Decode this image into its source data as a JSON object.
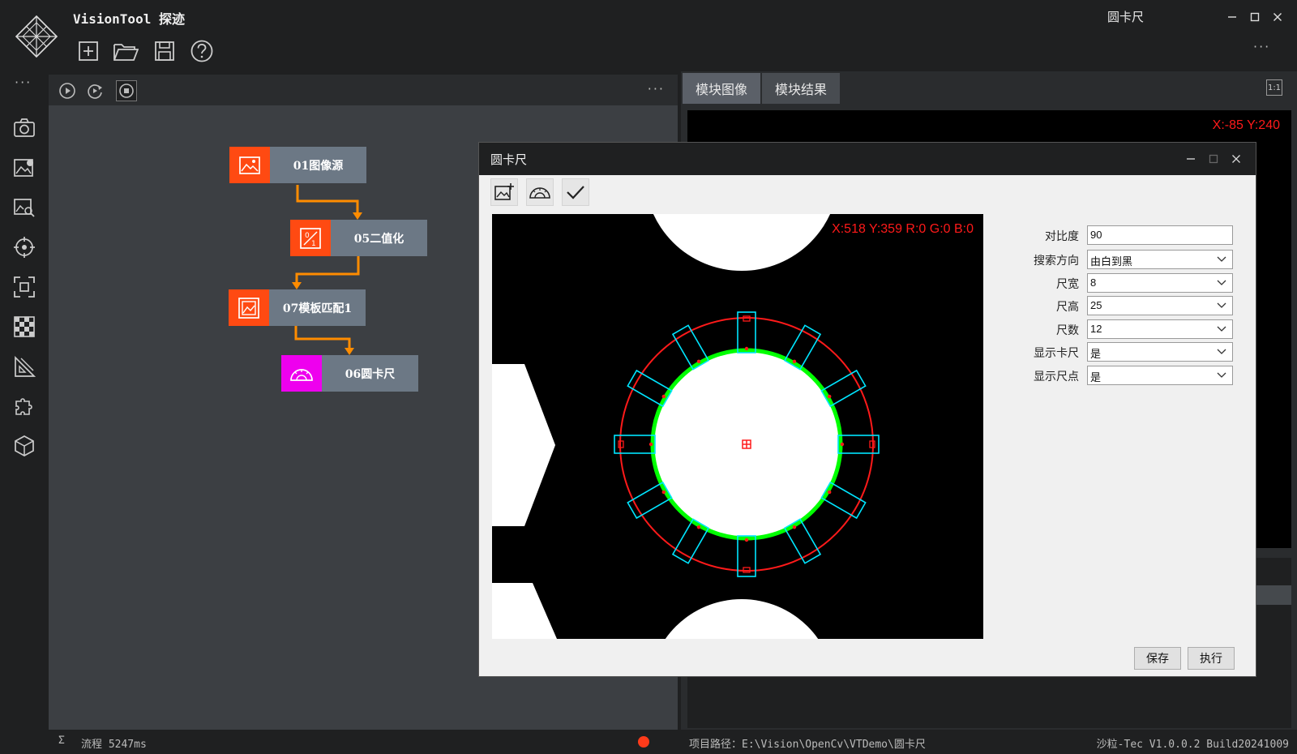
{
  "app": {
    "title": "VisionTool 探迹",
    "window_title": "圆卡尺",
    "more": "···"
  },
  "toolbar": {
    "items": [
      "new-file",
      "open-folder",
      "save",
      "help"
    ]
  },
  "left_strip": {
    "more": "···",
    "icons": [
      "camera-icon",
      "image-settings-icon",
      "image-search-icon",
      "target-icon",
      "focus-frame-icon",
      "checker-pattern-icon",
      "ruler-triangle-icon",
      "puzzle-icon",
      "cube-icon"
    ]
  },
  "flow": {
    "more": "···",
    "controls": [
      "run-icon",
      "loop-run-icon",
      "stop-icon"
    ],
    "nodes": [
      {
        "label": "01图像源",
        "icon": "image-icon",
        "color": "#ff4a12"
      },
      {
        "label": "05二值化",
        "icon": "binarize-icon",
        "color": "#ff4a12"
      },
      {
        "label": "07模板匹配1",
        "icon": "template-match-icon",
        "color": "#ff4a12"
      },
      {
        "label": "06圆卡尺",
        "icon": "protractor-icon",
        "color": "#ee00ee"
      }
    ],
    "arrow_color": "#ff8c00"
  },
  "status": {
    "sigma": "Σ",
    "flow_time": "流程 5247ms",
    "dot_color": "#ff3b1a",
    "project_path": "项目路径：E:\\Vision\\OpenCv\\VTDemo\\圆卡尺",
    "version": "沙粒-Tec V1.0.0.2 Build20241009"
  },
  "right_panel": {
    "tabs": [
      {
        "label": "模块图像",
        "active": true
      },
      {
        "label": "模块结果",
        "active": false
      }
    ],
    "one_to_one": "1:1",
    "coord": "X:-85 Y:240"
  },
  "dialog": {
    "title": "圆卡尺",
    "tools": [
      "image-add-icon",
      "protractor-icon",
      "check-icon"
    ],
    "coord": "X:518 Y:359  R:0 G:0 B:0",
    "params": [
      {
        "label": "对比度",
        "value": "90",
        "type": "input"
      },
      {
        "label": "搜索方向",
        "value": "由白到黑",
        "type": "select"
      },
      {
        "label": "尺宽",
        "value": "8",
        "type": "select"
      },
      {
        "label": "尺高",
        "value": "25",
        "type": "select"
      },
      {
        "label": "尺数",
        "value": "12",
        "type": "select"
      },
      {
        "label": "显示卡尺",
        "value": "是",
        "type": "select"
      },
      {
        "label": "显示尺点",
        "value": "是",
        "type": "select"
      }
    ],
    "buttons": {
      "save": "保存",
      "execute": "执行"
    },
    "caliper_count": 12,
    "colors": {
      "circle": "#ff1a1a",
      "caliper": "#00e5ff",
      "edge": "#00ff00"
    }
  }
}
